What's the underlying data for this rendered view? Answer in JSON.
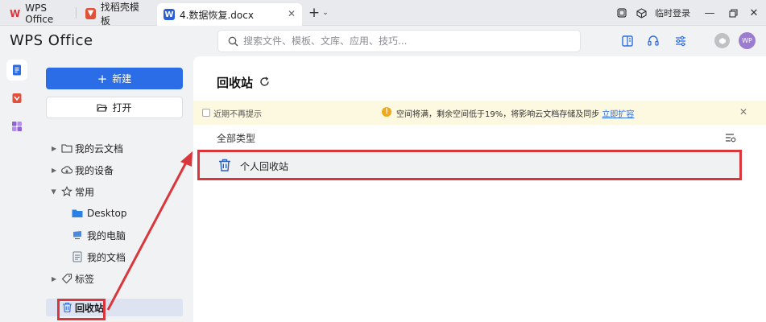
{
  "tabs": [
    {
      "label": "WPS Office",
      "icon": "wps-logo-icon",
      "color": "#d9373c"
    },
    {
      "label": "找稻壳模板",
      "icon": "docer-icon",
      "color": "#e0503a"
    },
    {
      "label": "4.数据恢复.docx",
      "icon": "word-doc-icon",
      "color": "#2b5fd9"
    }
  ],
  "titlebar": {
    "temp_login": "临时登录"
  },
  "header": {
    "logo": "WPS Office",
    "search_placeholder": "搜索文件、模板、文库、应用、技巧...",
    "avatar_initials": "WP"
  },
  "sidebar": {
    "new_label": "新建",
    "open_label": "打开",
    "items": [
      {
        "label": "我的云文档",
        "icon": "cloud-folder-icon"
      },
      {
        "label": "我的设备",
        "icon": "device-cloud-icon"
      },
      {
        "label": "常用",
        "icon": "star-icon"
      },
      {
        "label": "Desktop",
        "icon": "folder-icon"
      },
      {
        "label": "我的电脑",
        "icon": "computer-icon"
      },
      {
        "label": "我的文档",
        "icon": "documents-icon"
      },
      {
        "label": "标签",
        "icon": "tag-icon"
      },
      {
        "label": "回收站",
        "icon": "trash-icon"
      }
    ]
  },
  "main": {
    "title": "回收站",
    "notice": {
      "dont_remind": "近期不再提示",
      "message": "空间将满，剩余空间低于19%，将影响云文档存储及同步",
      "link": "立即扩容"
    },
    "filter_label": "全部类型",
    "rows": [
      {
        "label": "个人回收站"
      }
    ]
  },
  "colors": {
    "accent": "#2b6de6",
    "annotation": "#d9373c",
    "notice_bg": "#fdf8e0"
  }
}
